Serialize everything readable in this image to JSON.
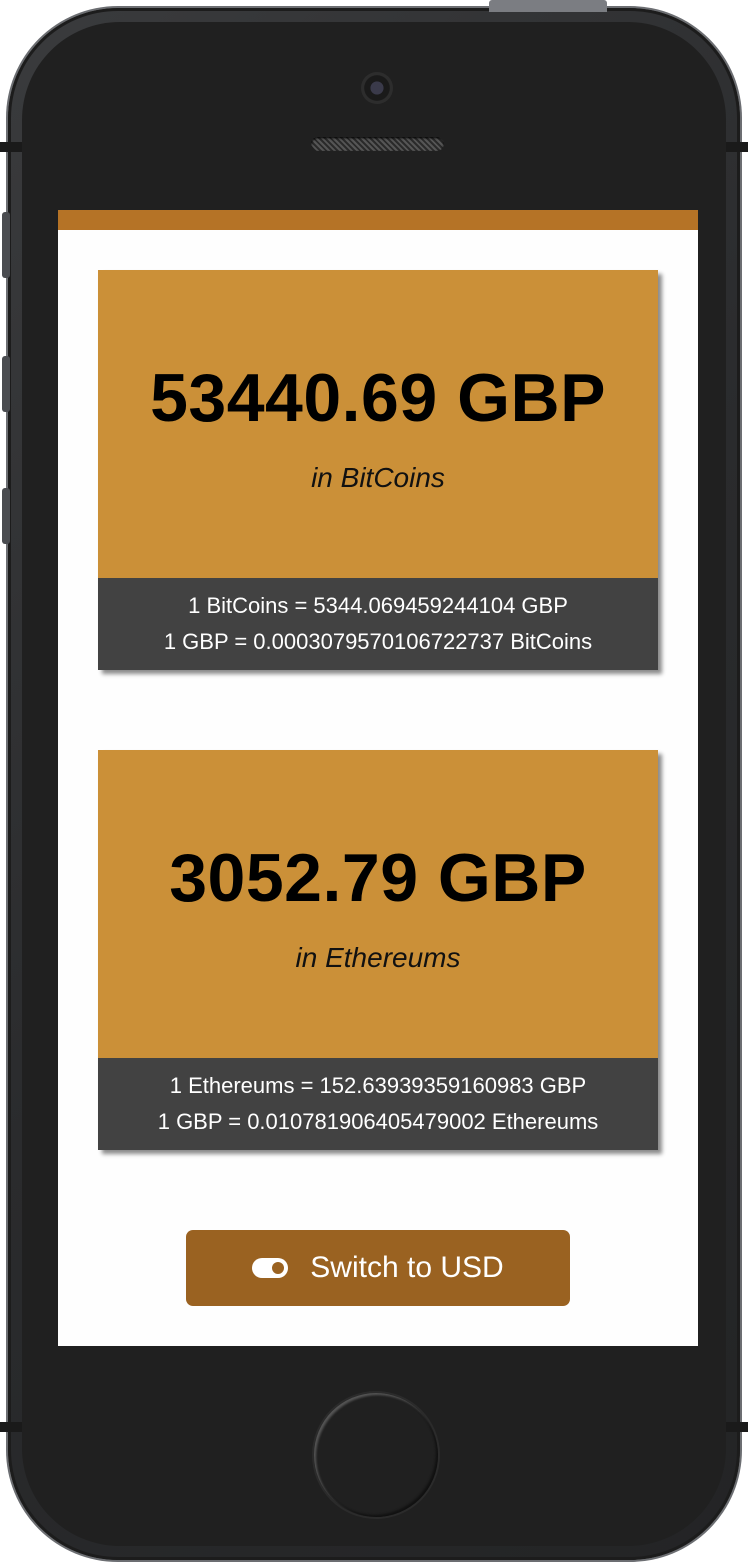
{
  "cards": [
    {
      "amount": "53440.69 GBP",
      "subtitle": "in BitCoins",
      "rate_line_1": "1 BitCoins = 5344.069459244104 GBP",
      "rate_line_2": "1 GBP = 0.0003079570106722737 BitCoins"
    },
    {
      "amount": "3052.79 GBP",
      "subtitle": "in Ethereums",
      "rate_line_1": "1 Ethereums = 152.63939359160983 GBP",
      "rate_line_2": "1 GBP = 0.010781906405479002 Ethereums"
    }
  ],
  "switch_button": {
    "label": "Switch to USD",
    "icon": "toggle-on-icon"
  },
  "colors": {
    "accent_bar": "#b57326",
    "card_background": "#cb9038",
    "card_footer": "#424242",
    "button_background": "#9a6221"
  }
}
